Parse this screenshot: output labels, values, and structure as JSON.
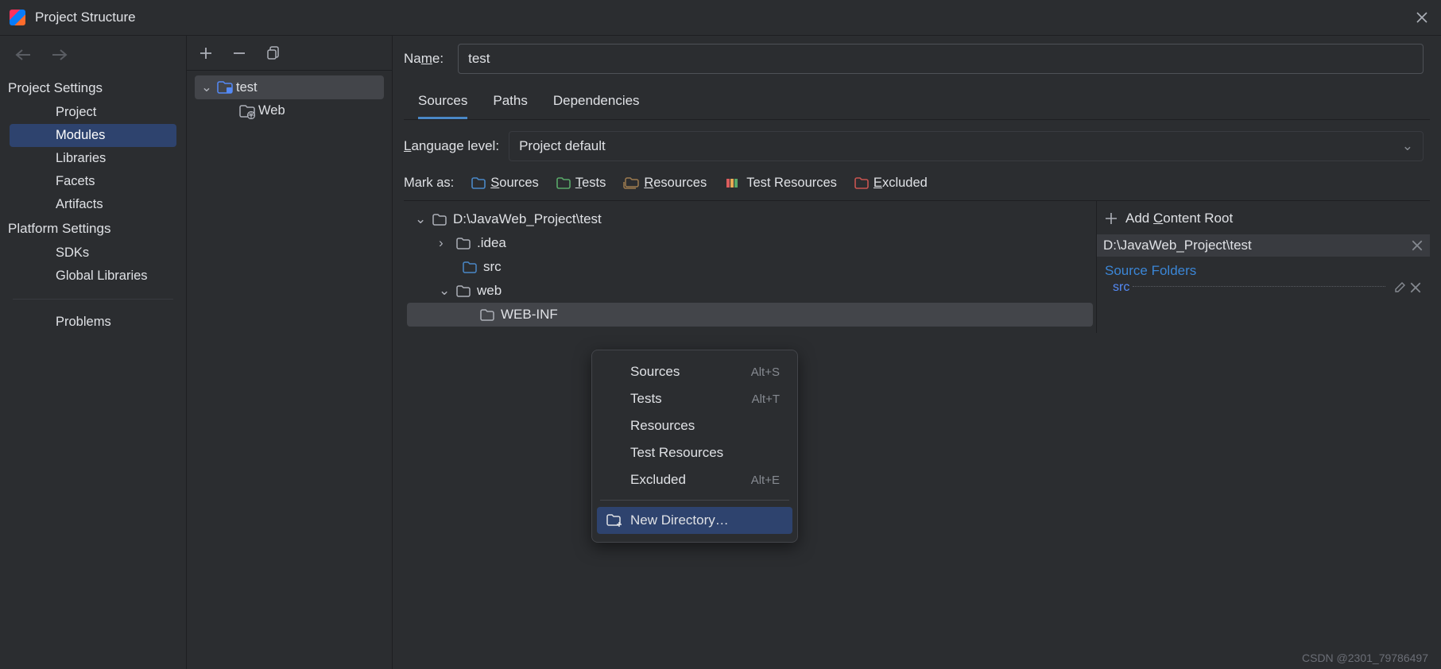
{
  "window": {
    "title": "Project Structure"
  },
  "nav": {
    "project_settings_header": "Project Settings",
    "platform_settings_header": "Platform Settings",
    "items": {
      "project": "Project",
      "modules": "Modules",
      "libraries": "Libraries",
      "facets": "Facets",
      "artifacts": "Artifacts",
      "sdks": "SDKs",
      "global_libraries": "Global Libraries",
      "problems": "Problems"
    }
  },
  "modules": {
    "tree": {
      "root": "test",
      "child": "Web"
    }
  },
  "detail": {
    "name_label_pre": "Na",
    "name_label_u": "m",
    "name_label_post": "e:",
    "name_value": "test",
    "tabs": {
      "sources": "Sources",
      "paths": "Paths",
      "dependencies": "Dependencies"
    },
    "lang_label_u": "L",
    "lang_label_post": "anguage level:",
    "lang_value": "Project default",
    "mark_label": "Mark as:",
    "marks": {
      "sources_u": "S",
      "sources_post": "ources",
      "tests_u": "T",
      "tests_post": "ests",
      "resources_u": "R",
      "resources_post": "esources",
      "test_resources": "Test Resources",
      "excluded_u": "E",
      "excluded_post": "xcluded"
    },
    "tree": {
      "root": "D:\\JavaWeb_Project\\test",
      "idea": ".idea",
      "src": "src",
      "web": "web",
      "webinf": "WEB-INF"
    },
    "roots": {
      "add_pre": "Add ",
      "add_u": "C",
      "add_post": "ontent Root",
      "path": "D:\\JavaWeb_Project\\test",
      "source_folders_header": "Source Folders",
      "src": "src"
    }
  },
  "context_menu": {
    "sources": "Sources",
    "sources_sc": "Alt+S",
    "tests": "Tests",
    "tests_sc": "Alt+T",
    "resources": "Resources",
    "test_resources": "Test Resources",
    "excluded": "Excluded",
    "excluded_sc": "Alt+E",
    "new_directory": "New Directory…"
  },
  "watermark": "CSDN @2301_79786497",
  "colors": {
    "sources": "#4a88c7",
    "tests": "#59a869",
    "resources": "#9d7b4f",
    "test_resources_1": "#59a869",
    "excluded": "#c75450"
  }
}
